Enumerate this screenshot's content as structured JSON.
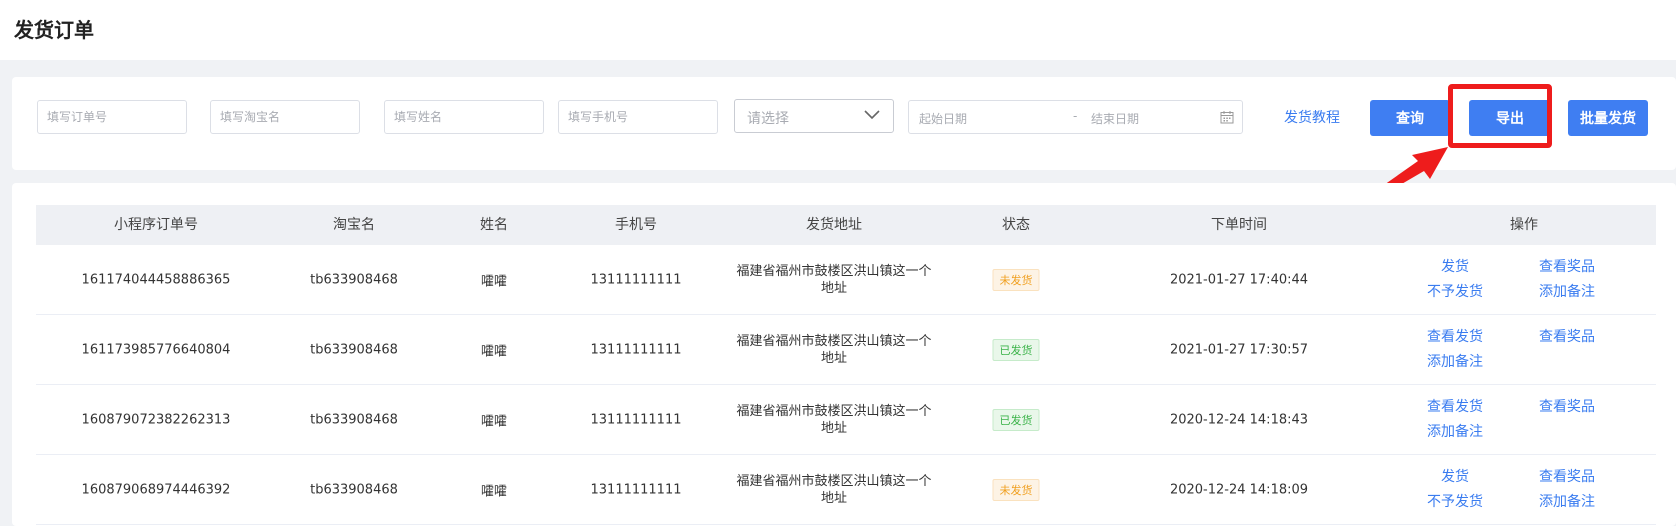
{
  "page": {
    "title": "发货订单"
  },
  "filters": {
    "order_no_placeholder": "填写订单号",
    "taobao_name_placeholder": "填写淘宝名",
    "name_placeholder": "填写姓名",
    "phone_placeholder": "填写手机号",
    "status_select_placeholder": "请选择",
    "start_date_placeholder": "起始日期",
    "date_separator": "-",
    "end_date_placeholder": "结束日期",
    "tutorial_link": "发货教程",
    "query_button": "查询",
    "export_button": "导出",
    "batch_ship_button": "批量发货"
  },
  "table": {
    "columns": [
      "小程序订单号",
      "淘宝名",
      "姓名",
      "手机号",
      "发货地址",
      "状态",
      "下单时间",
      "操作"
    ],
    "rows": [
      {
        "order_no": "161174044458886365",
        "taobao_name": "tb633908468",
        "name": "嚯嚯",
        "phone": "13111111111",
        "address": "福建省福州市鼓楼区洪山镇这一个地址",
        "status": "未发货",
        "status_type": "pending",
        "time": "2021-01-27 17:40:44",
        "ops": [
          "发货",
          "查看奖品",
          "不予发货",
          "添加备注"
        ]
      },
      {
        "order_no": "161173985776640804",
        "taobao_name": "tb633908468",
        "name": "嚯嚯",
        "phone": "13111111111",
        "address": "福建省福州市鼓楼区洪山镇这一个地址",
        "status": "已发货",
        "status_type": "shipped",
        "time": "2021-01-27 17:30:57",
        "ops": [
          "查看发货",
          "查看奖品",
          "添加备注"
        ]
      },
      {
        "order_no": "160879072382262313",
        "taobao_name": "tb633908468",
        "name": "嚯嚯",
        "phone": "13111111111",
        "address": "福建省福州市鼓楼区洪山镇这一个地址",
        "status": "已发货",
        "status_type": "shipped",
        "time": "2020-12-24 14:18:43",
        "ops": [
          "查看发货",
          "查看奖品",
          "添加备注"
        ]
      },
      {
        "order_no": "160879068974446392",
        "taobao_name": "tb633908468",
        "name": "嚯嚯",
        "phone": "13111111111",
        "address": "福建省福州市鼓楼区洪山镇这一个地址",
        "status": "未发货",
        "status_type": "pending",
        "time": "2020-12-24 14:18:09",
        "ops": [
          "发货",
          "查看奖品",
          "不予发货",
          "添加备注"
        ]
      }
    ]
  },
  "colors": {
    "primary": "#3f7ef2",
    "highlight": "#ee1c1c",
    "pending": "#f0a020",
    "shipped": "#3bb349"
  },
  "icons": {
    "select": "chevron-down-icon",
    "date": "calendar-icon",
    "annotation": "arrow-icon"
  }
}
